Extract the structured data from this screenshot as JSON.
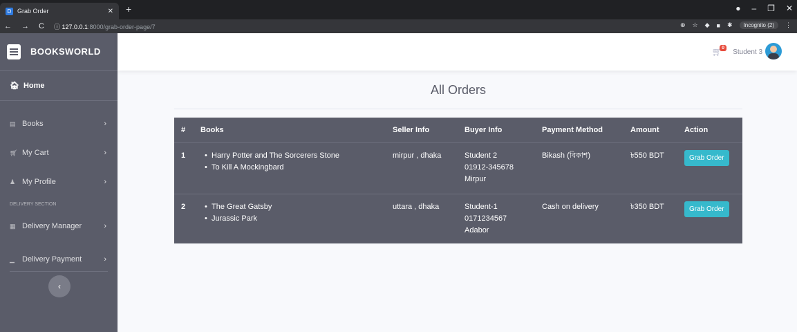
{
  "browser": {
    "tab_title": "Grab Order",
    "tab_favicon": "D",
    "url_host": "127.0.0.1",
    "url_path": ":8000/grab-order-page/7",
    "incognito_label": "Incognito (2)"
  },
  "sidebar": {
    "brand": "BOOKSWORLD",
    "home": "Home",
    "items": [
      {
        "label": "Books",
        "icon": "book-icon"
      },
      {
        "label": "My Cart",
        "icon": "cart-icon"
      },
      {
        "label": "My Profile",
        "icon": "user-icon"
      }
    ],
    "section_heading": "DELIVERY SECTION",
    "delivery_items": [
      {
        "label": "Delivery Manager",
        "icon": "table-icon"
      },
      {
        "label": "Delivery Payment",
        "icon": "chart-icon"
      }
    ]
  },
  "topbar": {
    "cart_count": "0",
    "username": "Student 3"
  },
  "main": {
    "title": "All Orders",
    "columns": [
      "#",
      "Books",
      "Seller Info",
      "Buyer Info",
      "Payment Method",
      "Amount",
      "Action"
    ],
    "orders": [
      {
        "num": "1",
        "books": [
          "Harry Potter and The Sorcerers Stone",
          "To Kill A Mockingbard"
        ],
        "seller": "mirpur , dhaka",
        "buyer_name": "Student 2",
        "buyer_phone": "01912-345678",
        "buyer_area": "Mirpur",
        "payment": "Bikash (বিকাশ)",
        "amount": "৳550 BDT",
        "action": "Grab Order"
      },
      {
        "num": "2",
        "books": [
          "The Great Gatsby",
          "Jurassic Park"
        ],
        "seller": "uttara , dhaka",
        "buyer_name": "Student-1",
        "buyer_phone": "0171234567",
        "buyer_area": "Adabor",
        "payment": "Cash on delivery",
        "amount": "৳350 BDT",
        "action": "Grab Order"
      }
    ]
  },
  "colors": {
    "sidebar_bg": "#5a5c69",
    "accent_button": "#36b9cc",
    "badge": "#e74a3b"
  }
}
